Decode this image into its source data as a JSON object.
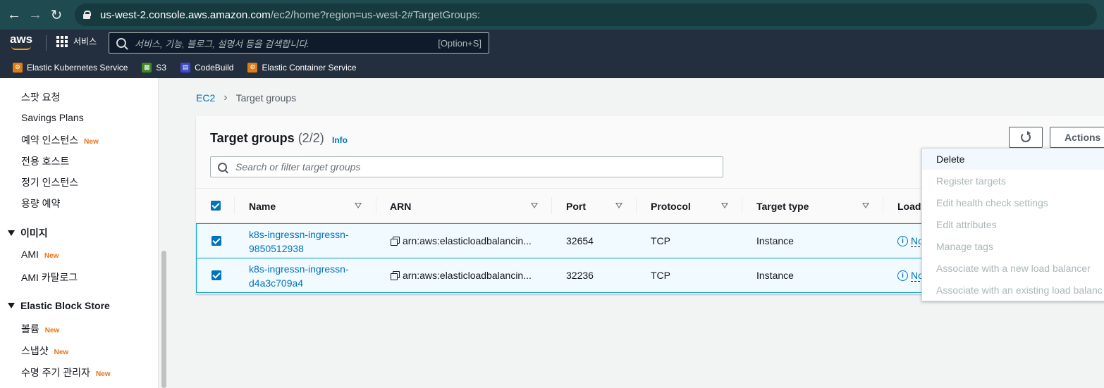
{
  "browser": {
    "url_host": "us-west-2.console.aws.amazon.com",
    "url_path": "/ec2/home?region=us-west-2#TargetGroups:"
  },
  "header": {
    "logo_text": "aws",
    "services_label": "서비스",
    "search_placeholder": "서비스, 기능, 블로그, 설명서 등을 검색합니다.",
    "search_shortcut": "[Option+S]"
  },
  "favorites": [
    {
      "label": "Elastic Kubernetes Service",
      "color": "#e07b11"
    },
    {
      "label": "S3",
      "color": "#3f8624"
    },
    {
      "label": "CodeBuild",
      "color": "#3b48cc"
    },
    {
      "label": "Elastic Container Service",
      "color": "#e07b11"
    }
  ],
  "sidebar": {
    "items": [
      {
        "label": "스팟 요청",
        "new": ""
      },
      {
        "label": "Savings Plans",
        "new": ""
      },
      {
        "label": "예약 인스턴스",
        "new": "New"
      },
      {
        "label": "전용 호스트",
        "new": ""
      },
      {
        "label": "정기 인스턴스",
        "new": ""
      },
      {
        "label": "용량 예약",
        "new": ""
      }
    ],
    "section_images": "이미지",
    "images_items": [
      {
        "label": "AMI",
        "new": "New"
      },
      {
        "label": "AMI 카탈로그",
        "new": ""
      }
    ],
    "section_ebs": "Elastic Block Store",
    "ebs_items": [
      {
        "label": "볼륨",
        "new": "New"
      },
      {
        "label": "스냅샷",
        "new": "New"
      },
      {
        "label": "수명 주기 관리자",
        "new": "New"
      }
    ]
  },
  "breadcrumb": {
    "root": "EC2",
    "current": "Target groups"
  },
  "panel": {
    "title": "Target groups",
    "count": "(2/2)",
    "info": "Info",
    "actions_label": "Actions",
    "filter_placeholder": "Search or filter target groups"
  },
  "table": {
    "columns": [
      "Name",
      "ARN",
      "Port",
      "Protocol",
      "Target type",
      "Load"
    ],
    "rows": [
      {
        "name_1": "k8s-ingressn-ingressn-",
        "name_2": "9850512938",
        "arn": "arn:aws:elasticloadbalancin...",
        "port": "32654",
        "protocol": "TCP",
        "target_type": "Instance",
        "lb": "No"
      },
      {
        "name_1": "k8s-ingressn-ingressn-",
        "name_2": "d4a3c709a4",
        "arn": "arn:aws:elasticloadbalancin...",
        "port": "32236",
        "protocol": "TCP",
        "target_type": "Instance",
        "lb": "No"
      }
    ]
  },
  "actions_menu": [
    "Delete",
    "Register targets",
    "Edit health check settings",
    "Edit attributes",
    "Manage tags",
    "Associate with a new load balancer",
    "Associate with an existing load balanc"
  ]
}
